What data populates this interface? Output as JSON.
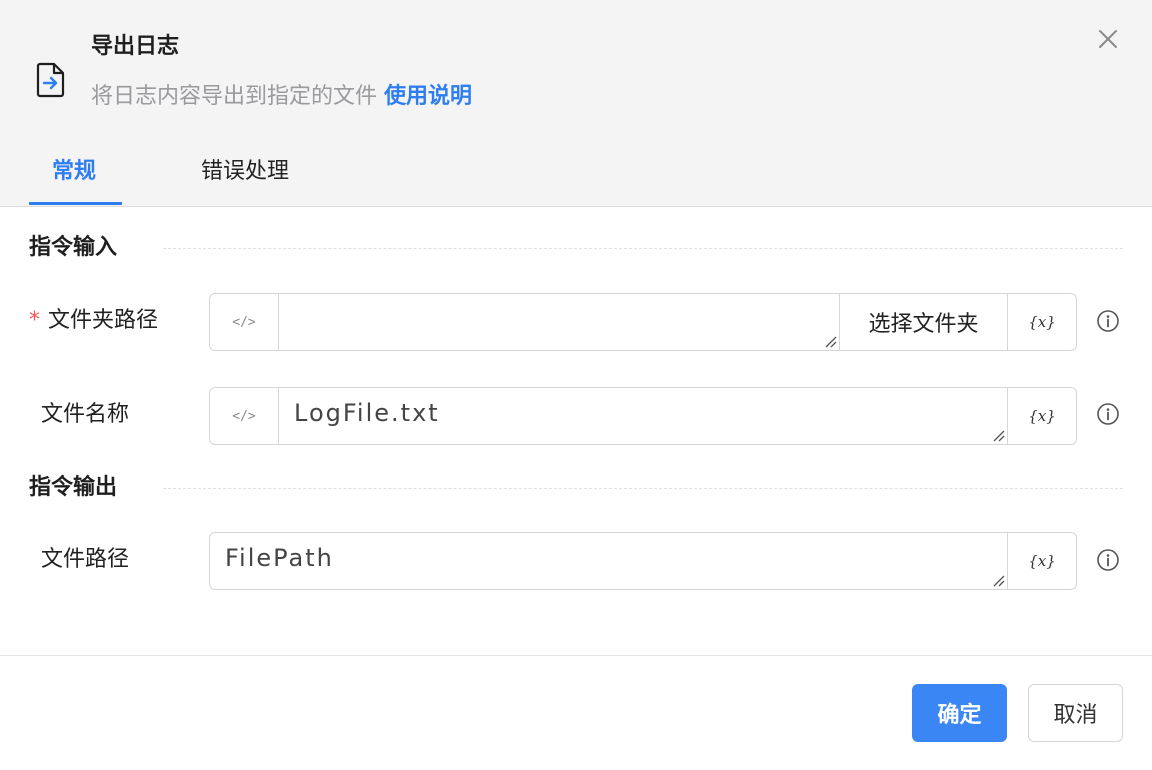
{
  "header": {
    "title": "导出日志",
    "subtitle": "将日志内容导出到指定的文件",
    "help_link": "使用说明"
  },
  "tabs": [
    {
      "label": "常规",
      "active": true
    },
    {
      "label": "错误处理",
      "active": false
    }
  ],
  "sections": {
    "input_title": "指令输入",
    "output_title": "指令输出"
  },
  "fields": {
    "folder_path": {
      "label": "文件夹路径",
      "required": true,
      "value": "",
      "button": "选择文件夹"
    },
    "file_name": {
      "label": "文件名称",
      "value": "LogFile.txt"
    },
    "file_path": {
      "label": "文件路径",
      "value": "FilePath"
    }
  },
  "symbols": {
    "code_toggle": "</>",
    "variable": "{x}",
    "required_mark": "*"
  },
  "footer": {
    "ok_label": "确定",
    "cancel_label": "取消"
  },
  "colors": {
    "accent": "#2f7ef0",
    "primary_button": "#3b86f5",
    "required": "#f25757"
  }
}
